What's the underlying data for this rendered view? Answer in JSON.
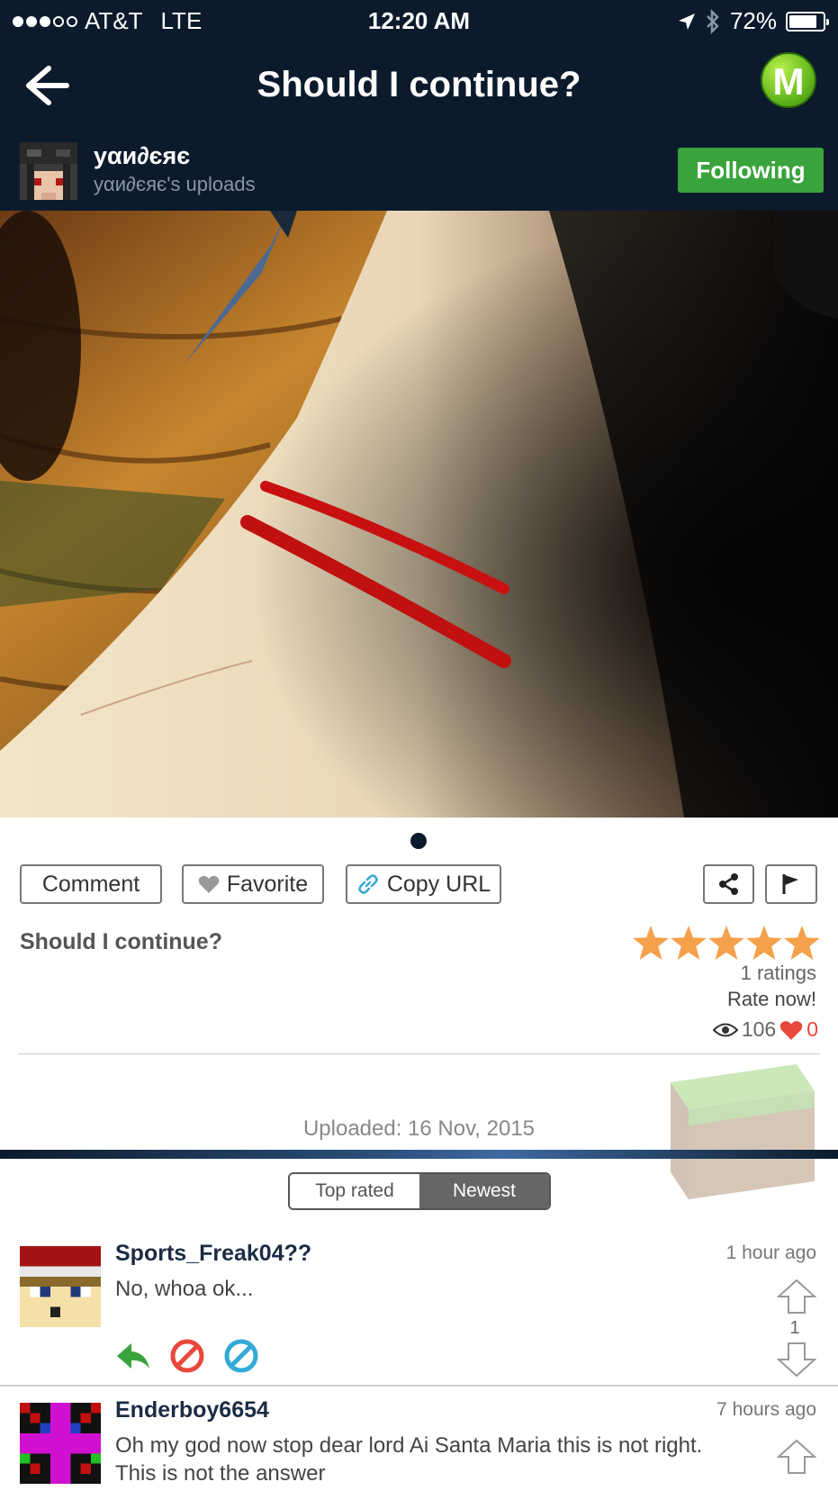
{
  "status_bar": {
    "carrier": "AT&T",
    "network": "LTE",
    "time": "12:20 AM",
    "battery": "72%",
    "battery_level": 0.72,
    "signal_bars": 3,
    "signal_total": 5
  },
  "header": {
    "title": "Should I continue?",
    "logo_letter": "M"
  },
  "uploader": {
    "name": "уαи∂єяє",
    "subtitle": "уαи∂єяє's uploads",
    "follow_label": "Following"
  },
  "actions": {
    "comment_label": "Comment",
    "favorite_label": "Favorite",
    "copy_url_label": "Copy URL"
  },
  "post": {
    "title": "Should I continue?",
    "star_rating": 5,
    "ratings_text": "1 ratings",
    "rate_now": "Rate now!",
    "views": "106",
    "favorites": "0",
    "uploaded": "Uploaded: 16 Nov, 2015"
  },
  "sort_tabs": {
    "top_rated": "Top rated",
    "newest": "Newest",
    "selected": "Newest"
  },
  "comments": [
    {
      "author": "Sports_Freak04??",
      "time": "1 hour ago",
      "text": "No, whoa ok...",
      "votes": "1"
    },
    {
      "author": "Enderboy6654",
      "time": "7 hours ago",
      "text": "Oh my god now stop dear lord Ai Santa Maria this is not right. This is not the answer"
    }
  ],
  "colors": {
    "header_bg": "#0c1b2c",
    "follow_green": "#3aa43c",
    "star_orange": "#f5a04a",
    "heart_red": "#e8483a"
  }
}
